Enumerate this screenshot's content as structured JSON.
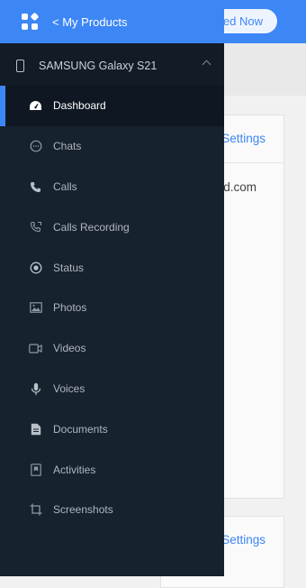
{
  "drawer": {
    "back_label": "< My Products",
    "device_name": "SAMSUNG Galaxy S21",
    "items": [
      {
        "label": "Dashboard",
        "icon": "dashboard-icon",
        "active": true
      },
      {
        "label": "Chats",
        "icon": "chat-icon",
        "active": false
      },
      {
        "label": "Calls",
        "icon": "phone-icon",
        "active": false
      },
      {
        "label": "Calls Recording",
        "icon": "call-recording-icon",
        "active": false
      },
      {
        "label": "Status",
        "icon": "status-icon",
        "active": false
      },
      {
        "label": "Photos",
        "icon": "photo-icon",
        "active": false
      },
      {
        "label": "Videos",
        "icon": "video-icon",
        "active": false
      },
      {
        "label": "Voices",
        "icon": "microphone-icon",
        "active": false
      },
      {
        "label": "Documents",
        "icon": "document-icon",
        "active": false
      },
      {
        "label": "Activities",
        "icon": "activity-icon",
        "active": false
      },
      {
        "label": "Screenshots",
        "icon": "screenshot-icon",
        "active": false
      }
    ]
  },
  "background": {
    "cta_label": "ed Now",
    "card1_settings": "Settings",
    "card1_email": "d.com",
    "card2_settings": "Settings"
  },
  "colors": {
    "accent": "#3d86f5",
    "drawer_bg": "#17222f",
    "active_bg": "#0f1822"
  }
}
